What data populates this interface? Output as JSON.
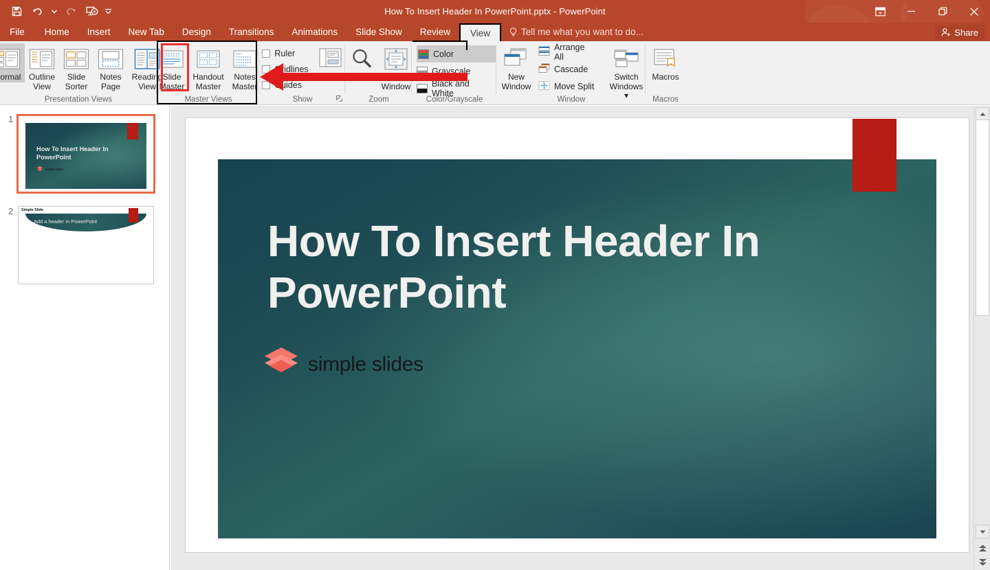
{
  "window": {
    "title": "How To Insert Header In PowerPoint.pptx - PowerPoint",
    "accent_color": "#b7472a",
    "quick_access": [
      {
        "name": "save",
        "icon": "save-icon",
        "enabled": true
      },
      {
        "name": "undo",
        "icon": "undo-icon",
        "enabled": true
      },
      {
        "name": "undo-dropdown",
        "icon": "chevron-down-icon",
        "enabled": true
      },
      {
        "name": "redo",
        "icon": "redo-icon",
        "enabled": false
      },
      {
        "name": "start-slideshow",
        "icon": "slideshow-icon",
        "enabled": true
      },
      {
        "name": "customize-qat",
        "icon": "chevron-down-icon",
        "enabled": true
      }
    ],
    "controls": [
      {
        "name": "ribbon-display-options",
        "icon": "ribbon-display-icon"
      },
      {
        "name": "minimize",
        "icon": "minimize-icon"
      },
      {
        "name": "restore",
        "icon": "restore-icon"
      },
      {
        "name": "close",
        "icon": "close-icon"
      }
    ],
    "share_label": "Share"
  },
  "tabs": {
    "items": [
      {
        "label": "File",
        "active": false
      },
      {
        "label": "Home",
        "active": false
      },
      {
        "label": "Insert",
        "active": false
      },
      {
        "label": "New Tab",
        "active": false
      },
      {
        "label": "Design",
        "active": false
      },
      {
        "label": "Transitions",
        "active": false
      },
      {
        "label": "Animations",
        "active": false
      },
      {
        "label": "Slide Show",
        "active": false
      },
      {
        "label": "Review",
        "active": false
      },
      {
        "label": "View",
        "active": true
      }
    ],
    "tell_me_placeholder": "Tell me what you want to do..."
  },
  "ribbon": {
    "groups": [
      {
        "name": "presentation-views",
        "label": "Presentation Views",
        "buttons": [
          {
            "label_line1": "Normal",
            "label_line2": "",
            "icon": "normal-view-icon",
            "selected": true
          },
          {
            "label_line1": "Outline",
            "label_line2": "View",
            "icon": "outline-view-icon",
            "selected": false
          },
          {
            "label_line1": "Slide",
            "label_line2": "Sorter",
            "icon": "slide-sorter-icon",
            "selected": false
          },
          {
            "label_line1": "Notes",
            "label_line2": "Page",
            "icon": "notes-page-icon",
            "selected": false
          },
          {
            "label_line1": "Reading",
            "label_line2": "View",
            "icon": "reading-view-icon",
            "selected": false
          }
        ]
      },
      {
        "name": "master-views",
        "label": "Master Views",
        "highlighted": true,
        "buttons": [
          {
            "label_line1": "Slide",
            "label_line2": "Master",
            "icon": "slide-master-icon",
            "highlighted": true
          },
          {
            "label_line1": "Handout",
            "label_line2": "Master",
            "icon": "handout-master-icon",
            "highlighted": false
          },
          {
            "label_line1": "Notes",
            "label_line2": "Master",
            "icon": "notes-master-icon",
            "highlighted": false
          }
        ]
      },
      {
        "name": "show",
        "label": "Show",
        "checkboxes": [
          {
            "label": "Ruler",
            "checked": false
          },
          {
            "label": "Gridlines",
            "checked": false
          },
          {
            "label": "Guides",
            "checked": false
          }
        ],
        "buttons": [
          {
            "label_line1": "Notes",
            "label_line2": "",
            "icon": "notes-icon"
          }
        ],
        "has_dialog_launcher": true
      },
      {
        "name": "zoom",
        "label": "Zoom",
        "buttons": [
          {
            "label_line1": "Zoom",
            "label_line2": "",
            "icon": "magnifier-icon"
          },
          {
            "label_line1": "Fit to",
            "label_line2": "Window",
            "icon": "fit-to-window-icon"
          }
        ]
      },
      {
        "name": "color-grayscale",
        "label": "Color/Grayscale",
        "options": [
          {
            "label": "Color",
            "selected": true,
            "swatch": "color"
          },
          {
            "label": "Grayscale",
            "selected": false,
            "swatch": "grayscale"
          },
          {
            "label": "Black and White",
            "selected": false,
            "swatch": "bw"
          }
        ]
      },
      {
        "name": "window",
        "label": "Window",
        "buttons": [
          {
            "label_line1": "New",
            "label_line2": "Window",
            "icon": "new-window-icon"
          },
          {
            "label_line1": "Switch",
            "label_line2": "Windows",
            "icon": "switch-windows-icon",
            "dropdown": true
          }
        ],
        "small_buttons": [
          {
            "label": "Arrange All",
            "icon": "arrange-all-icon"
          },
          {
            "label": "Cascade",
            "icon": "cascade-icon"
          },
          {
            "label": "Move Split",
            "icon": "move-split-icon"
          }
        ]
      },
      {
        "name": "macros",
        "label": "Macros",
        "buttons": [
          {
            "label_line1": "Macros",
            "label_line2": "",
            "icon": "macros-icon"
          }
        ]
      }
    ],
    "collapse_icon": "chevron-up-icon"
  },
  "thumbnails": {
    "items": [
      {
        "number": "1",
        "selected": true,
        "title": "How To Insert Header In PowerPoint",
        "brand": "simple slides"
      },
      {
        "number": "2",
        "selected": false,
        "header": "Simple Slide",
        "title": "Add a header in PowerPoint"
      }
    ]
  },
  "slide": {
    "title": "How To Insert Header In PowerPoint",
    "brand": "simple slides",
    "brand_color": "#f4766b",
    "bg_dark": "#17434f",
    "bg_mid": "#2c6460",
    "title_color": "#f0f0ef"
  },
  "annotations": {
    "red_box_color": "#ef2d2d",
    "black_box_color": "#000000",
    "red_rect_color": "#b71c15",
    "arrow_color": "#e01b1b"
  },
  "scrollbar": {
    "up": "scroll-up-icon",
    "down": "scroll-down-icon",
    "previous_slide": "previous-slide-icon",
    "next_slide": "next-slide-icon"
  }
}
